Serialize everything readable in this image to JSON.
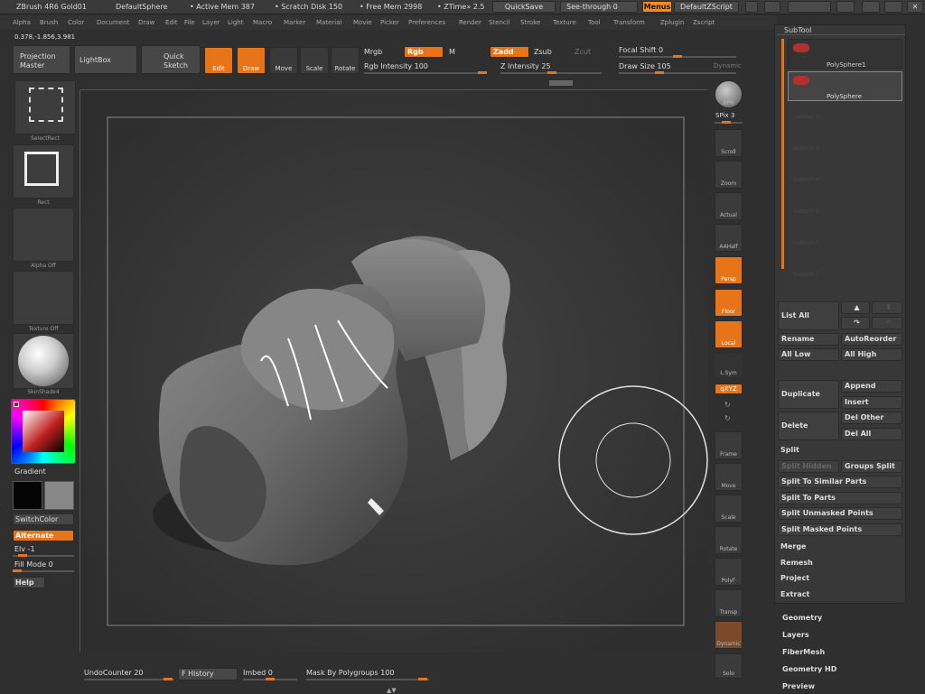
{
  "titlebar": {
    "app": "ZBrush 4R6 Gold01",
    "document": "DefaultSphere",
    "active_mem": "• Active Mem 387",
    "scratch": "• Scratch Disk 150",
    "free_mem": "• Free Mem 2998",
    "ztime": "• ZTime» 2.5",
    "quicksave": "QuickSave",
    "seethrough": "See-through  0",
    "menus": "Menus",
    "zscript": "DefaultZScript"
  },
  "menubar": [
    "Alpha",
    "Brush",
    "Color",
    "Document",
    "Draw",
    "Edit",
    "File",
    "Layer",
    "Light",
    "Macro",
    "Marker",
    "Material",
    "Movie",
    "Picker",
    "Preferences",
    "Render",
    "Stencil",
    "Stroke",
    "Texture",
    "Tool",
    "Transform",
    "Zplugin",
    "Zscript"
  ],
  "coords": "0.378,-1.856,3.981",
  "toolbar": {
    "projection_master": "Projection Master",
    "lightbox": "LightBox",
    "quick_sketch": "Quick Sketch",
    "edit": "Edit",
    "draw": "Draw",
    "move": "Move",
    "scale": "Scale",
    "rotate": "Rotate",
    "mrgb": "Mrgb",
    "rgb": "Rgb",
    "m": "M",
    "zadd": "Zadd",
    "zsub": "Zsub",
    "zcut": "Zcut",
    "rgb_intensity": "Rgb  Intensity 100",
    "z_intensity": "Z  Intensity 25",
    "focal_shift": "Focal Shift 0",
    "draw_size": "Draw  Size 105",
    "dynamic": "Dynamic"
  },
  "left": {
    "selectrect": "SelectRect",
    "rect": "Rect",
    "alpha": "Alpha  Off",
    "texture": "Texture  Off",
    "material": "SkinShade4",
    "gradient": "Gradient",
    "switchcolor": "SwitchColor",
    "alternate": "Alternate",
    "elv": "Elv -1",
    "fill": "Fill Mode 0",
    "help": "Help"
  },
  "right": {
    "bpr": "BPR",
    "spix": "SPix 3",
    "scroll": "Scroll",
    "zoom": "Zoom",
    "actual": "Actual",
    "aahalf": "AAHalf",
    "persp": "Persp",
    "floor": "Floor",
    "local": "Local",
    "lsym": "L.Sym",
    "xyz": "qXYZ",
    "frame": "Frame",
    "move": "Move",
    "scale": "Scale",
    "rotate": "Rotate",
    "polyf": "PolyF",
    "transp": "Transp",
    "ghost": "Dynamic",
    "solo": "Solo"
  },
  "subtool": {
    "title": "SubTool",
    "items": [
      "PolySphere1",
      "PolySphere"
    ],
    "empty": [
      "Subtool 2",
      "Subtool 3",
      "Subtool 4",
      "Subtool 5",
      "Subtool 6",
      "Subtool 7"
    ],
    "list_all": "List  All",
    "rename": "Rename",
    "autoreorder": "AutoReorder",
    "all_low": "All  Low",
    "all_high": "All  High",
    "duplicate": "Duplicate",
    "append": "Append",
    "insert": "Insert",
    "delete": "Delete",
    "del_other": "Del  Other",
    "del_all": "Del  All",
    "split": "Split",
    "split_hidden": "Split  Hidden",
    "groups_split": "Groups  Split",
    "split_similar": "Split  To  Similar  Parts",
    "split_parts": "Split  To  Parts",
    "split_unmasked": "Split  Unmasked  Points",
    "split_masked": "Split  Masked  Points",
    "merge": "Merge",
    "remesh": "Remesh",
    "project": "Project",
    "extract": "Extract"
  },
  "menu_sections": [
    "Geometry",
    "Layers",
    "FiberMesh",
    "Geometry HD",
    "Preview"
  ],
  "bottom": {
    "undo": "UndoCounter 20",
    "fhistory": "F History",
    "imbed": "Imbed 0",
    "mask": "Mask By Polygroups 100"
  },
  "colors": {
    "accent": "#e8741a",
    "panel": "#3a3a3a"
  }
}
